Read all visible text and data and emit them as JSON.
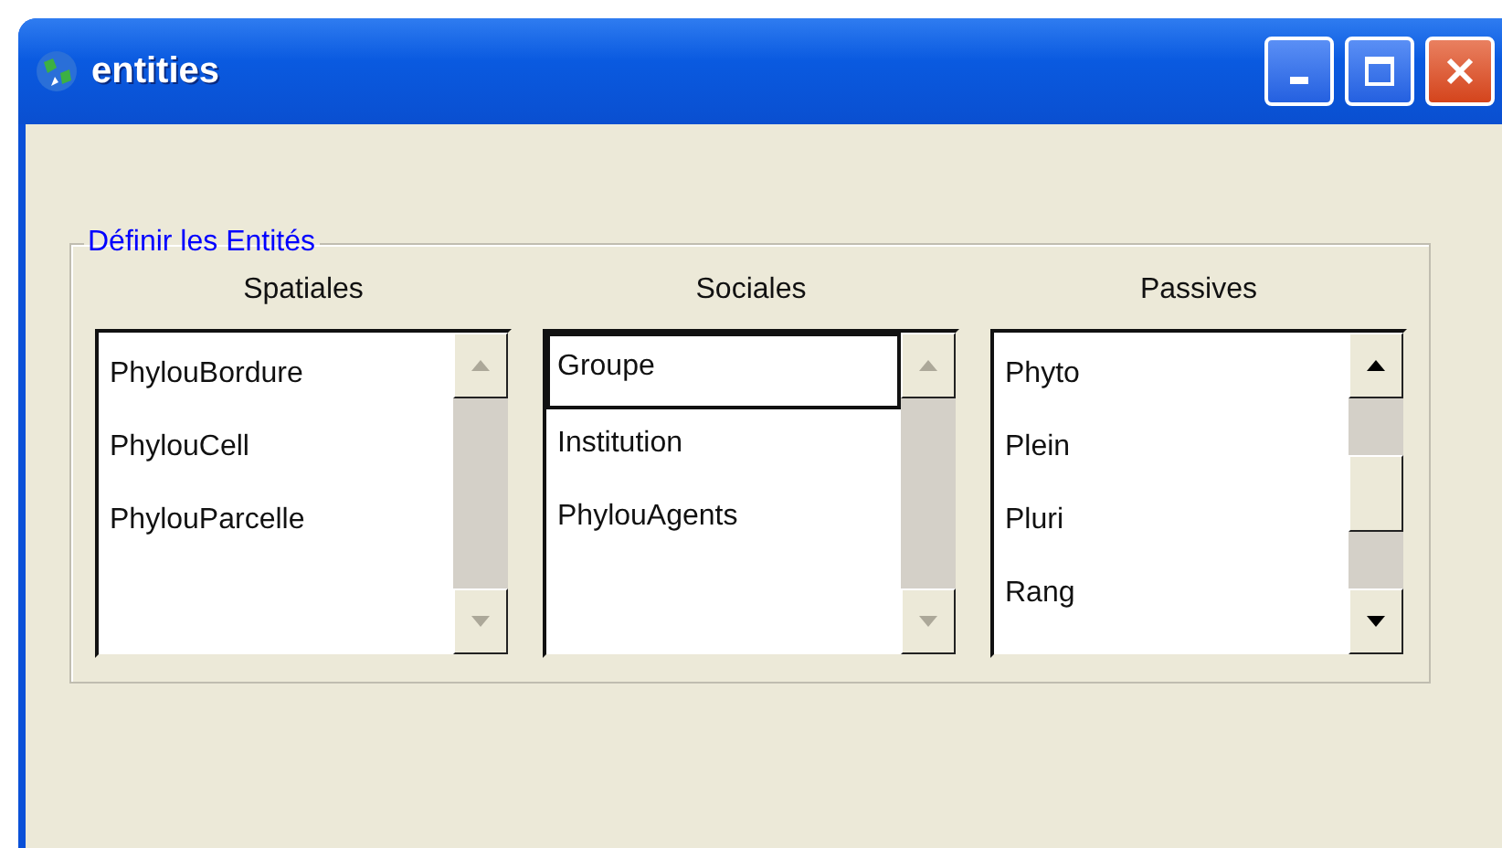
{
  "window": {
    "title": "entities"
  },
  "group": {
    "title": "Définir les Entités"
  },
  "lists": [
    {
      "heading": "Spatiales",
      "scroll_enabled": false,
      "items": [
        {
          "label": "PhylouBordure",
          "focused": false
        },
        {
          "label": "PhylouCell",
          "focused": false
        },
        {
          "label": "PhylouParcelle",
          "focused": false
        }
      ]
    },
    {
      "heading": "Sociales",
      "scroll_enabled": false,
      "items": [
        {
          "label": "Groupe",
          "focused": true
        },
        {
          "label": "Institution",
          "focused": false
        },
        {
          "label": "PhylouAgents",
          "focused": false
        }
      ]
    },
    {
      "heading": "Passives",
      "scroll_enabled": true,
      "items": [
        {
          "label": "Phyto",
          "focused": false
        },
        {
          "label": "Plein",
          "focused": false
        },
        {
          "label": "Pluri",
          "focused": false
        },
        {
          "label": "Rang",
          "focused": false
        }
      ]
    }
  ]
}
